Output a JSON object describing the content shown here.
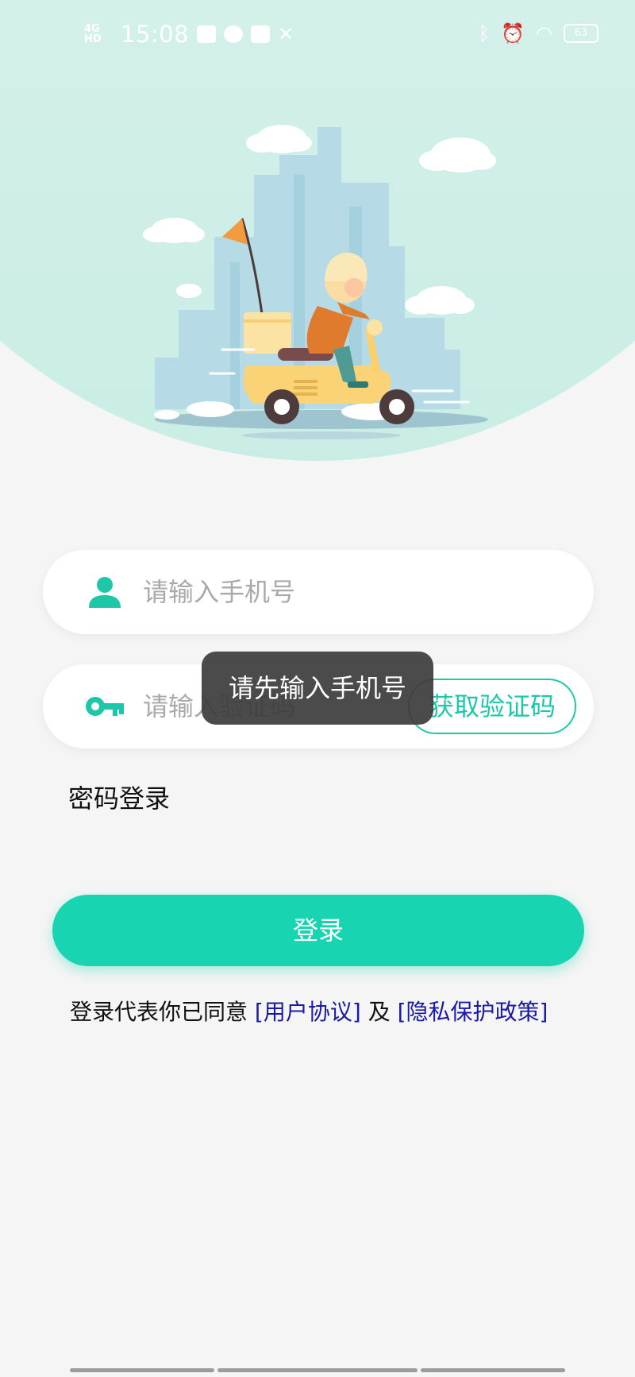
{
  "status_bar": {
    "network": "4G HD",
    "time": "15:08",
    "battery": "63"
  },
  "colors": {
    "accent": "#18d4b1",
    "accent_outline": "#1fc7a9",
    "link": "#1a1aa6",
    "hero_bg": "#d5f0ea"
  },
  "illustration": {
    "icon": "delivery-scooter-illustration"
  },
  "form": {
    "phone": {
      "icon": "user-icon",
      "placeholder": "请输入手机号",
      "value": ""
    },
    "code": {
      "icon": "key-icon",
      "placeholder": "请输入验证码",
      "value": "",
      "get_code_label": "获取验证码"
    },
    "password_login_label": "密码登录",
    "login_label": "登录"
  },
  "agreement": {
    "prefix": "登录代表你已同意",
    "user_agreement": "[用户协议]",
    "and": "及",
    "privacy_policy": "[隐私保护政策]"
  },
  "toast": {
    "message": "请先输入手机号"
  }
}
